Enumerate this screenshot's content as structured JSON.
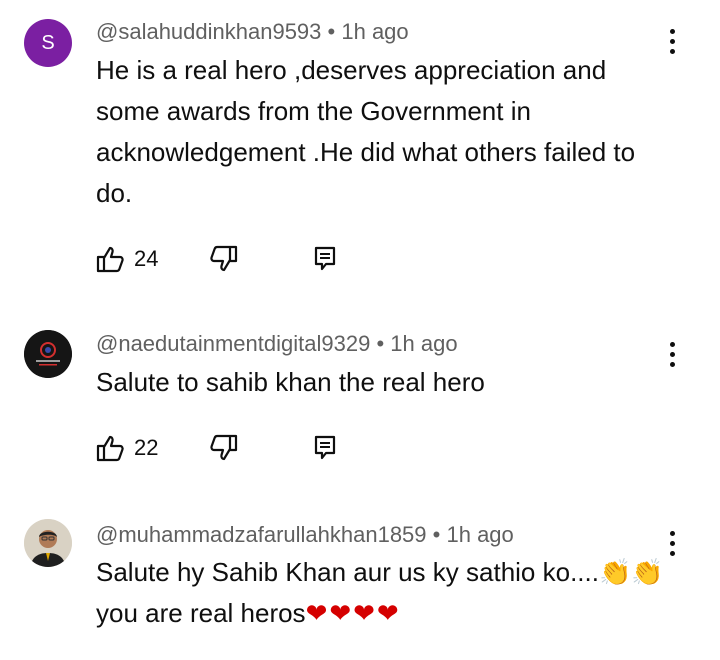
{
  "comments": [
    {
      "avatar_letter": "S",
      "author": "@salahuddinkhan9593",
      "separator": "•",
      "time": "1h ago",
      "text": "He is a real hero ,deserves appreciation and some awards from the Government in acknowledgement .He did what others failed to do.",
      "likes": "24"
    },
    {
      "author": "@naedutainmentdigital9329",
      "separator": "•",
      "time": "1h ago",
      "text": "Salute to sahib khan the real hero",
      "likes": "22"
    },
    {
      "author": "@muhammadzafarullahkhan1859",
      "separator": "•",
      "time": "1h ago",
      "text": "Salute hy Sahib Khan aur us ky sathio ko....👏👏",
      "text_line2": "you are real heros",
      "hearts": "❤❤❤❤"
    }
  ],
  "icons": {
    "like": "thumbs-up-icon",
    "dislike": "thumbs-down-icon",
    "reply": "reply-icon",
    "more": "more-vertical-icon"
  },
  "colors": {
    "avatar_purple": "#7b1fa2",
    "meta_gray": "#606060",
    "heart_red": "#d50000"
  }
}
